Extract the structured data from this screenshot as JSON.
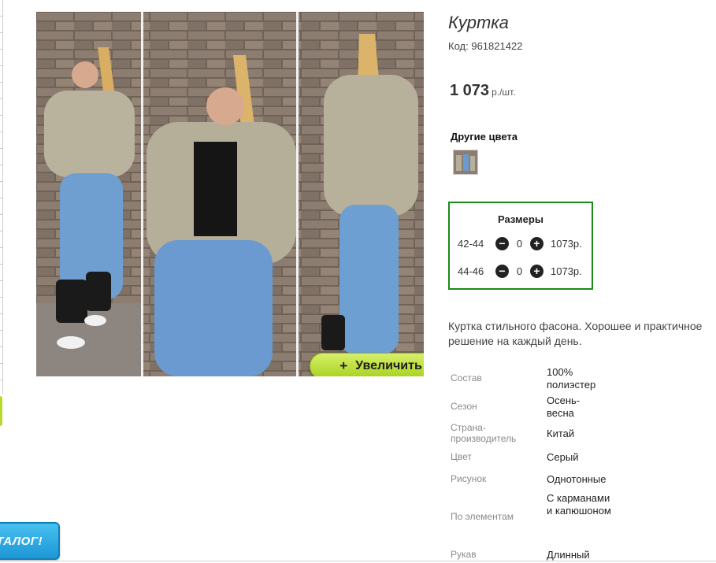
{
  "product": {
    "title": "Куртка",
    "code_label": "Код:",
    "code": "961821422",
    "price": "1 073",
    "price_unit": "р./шт."
  },
  "zoom_button": {
    "plus": "+",
    "label": "Увеличить"
  },
  "other_colors": {
    "label": "Другие цвета"
  },
  "sizes": {
    "title": "Размеры",
    "rows": [
      {
        "size": "42-44",
        "qty": "0",
        "price": "1073р."
      },
      {
        "size": "44-46",
        "qty": "0",
        "price": "1073р."
      }
    ],
    "minus_symbol": "−",
    "plus_symbol": "+"
  },
  "description": "Куртка стильного фасона. Хорошее и практичное решение на каждый день.",
  "specs": [
    {
      "label": "Состав",
      "value": "100% полиэстер"
    },
    {
      "label": "Сезон",
      "value": "Осень-весна"
    },
    {
      "label": "Страна-производитель",
      "value": "Китай"
    },
    {
      "label": "Цвет",
      "value": "Серый"
    },
    {
      "label": "Рисунок",
      "value": "Однотонные"
    },
    {
      "label": "По элементам",
      "value": "С карманами и капюшоном"
    },
    {
      "label": "Рукав",
      "value": "Длинный"
    }
  ],
  "catalog_button": {
    "label": "ТАЛОГ!"
  },
  "colors": {
    "accent_green": "#1a8a1a",
    "button_green": "#a7d11d",
    "catalog_blue": "#1b97d6"
  }
}
